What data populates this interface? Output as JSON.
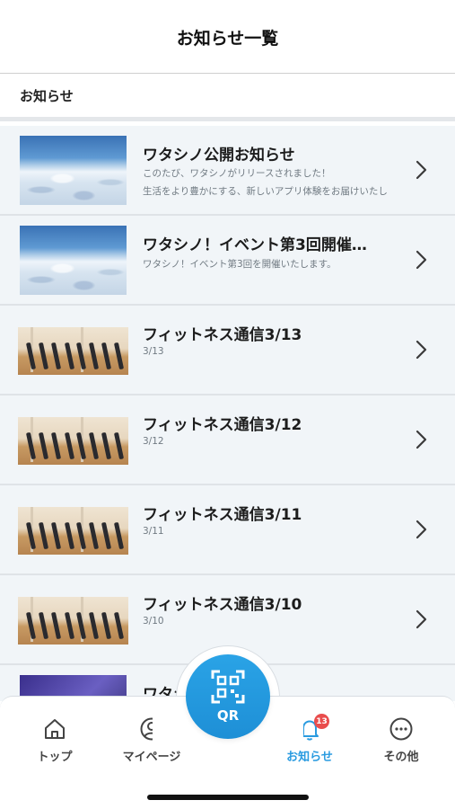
{
  "header": {
    "title": "お知らせ一覧"
  },
  "section": {
    "label": "お知らせ"
  },
  "news": [
    {
      "title": "ワタシノ公開お知らせ",
      "lines": [
        "このたび、ワタシノがリリースされました！",
        "生活をより豊かにする、新しいアプリ体験をお届けいたし"
      ],
      "thumb": "snow-field"
    },
    {
      "title": "ワタシノ！イベント第3回開催…",
      "lines": [
        "ワタシノ！イベント第3回を開催いたします。"
      ],
      "thumb": "snow-field"
    },
    {
      "title": "フィットネス通信3/13",
      "lines": [
        "3/13"
      ],
      "thumb": "fitness-class"
    },
    {
      "title": "フィットネス通信3/12",
      "lines": [
        "3/12"
      ],
      "thumb": "fitness-class"
    },
    {
      "title": "フィットネス通信3/11",
      "lines": [
        "3/11"
      ],
      "thumb": "fitness-class"
    },
    {
      "title": "フィットネス通信3/10",
      "lines": [
        "3/10"
      ],
      "thumb": "fitness-class"
    },
    {
      "title": "ワタシ",
      "lines": [],
      "thumb": "night-sky"
    }
  ],
  "tabbar": {
    "home": {
      "label": "トップ",
      "icon": "home-icon"
    },
    "mypage": {
      "label": "マイページ",
      "icon": "user-icon"
    },
    "qr": {
      "label": "QR",
      "icon": "qr-scan-icon"
    },
    "news": {
      "label": "お知らせ",
      "icon": "bell-icon",
      "badge": "13"
    },
    "other": {
      "label": "その他",
      "icon": "more-icon"
    }
  },
  "colors": {
    "accent": "#2a9be0",
    "badge": "#e94d4d",
    "list_bg": "#f1f5f8"
  }
}
